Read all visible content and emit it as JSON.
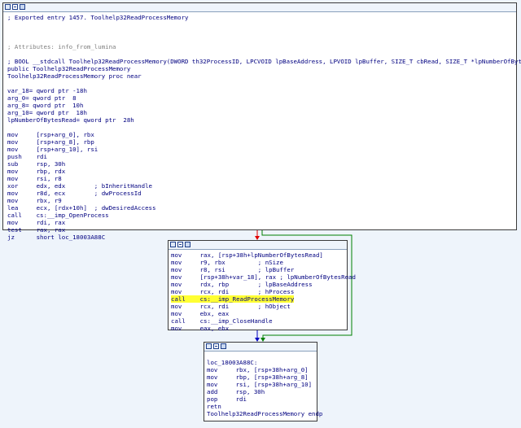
{
  "colors": {
    "background": "#eef4fb",
    "code_text": "#000080",
    "variable": "#008000",
    "import": "#ff00ff",
    "highlight": "#ffff33",
    "edge_red": "#e00000",
    "edge_green": "#008000",
    "edge_blue": "#0000c0"
  },
  "block1": {
    "lines": [
      "; Exported entry 1457. Toolhelp32ReadProcessMemory",
      "",
      "",
      "",
      "; Attributes: info_from_lumina",
      "",
      "; BOOL __stdcall Toolhelp32ReadProcessMemory(DWORD th32ProcessID, LPCVOID lpBaseAddress, LPVOID lpBuffer, SIZE_T cbRead, SIZE_T *lpNumberOfBytesRead)",
      "public Toolhelp32ReadProcessMemory",
      "Toolhelp32ReadProcessMemory proc near",
      "",
      "var_18= qword ptr -18h",
      "arg_0= qword ptr  8",
      "arg_8= qword ptr  10h",
      "arg_10= qword ptr  18h",
      "lpNumberOfBytesRead= qword ptr  28h",
      "",
      "mov     [rsp+arg_0], rbx",
      "mov     [rsp+arg_8], rbp",
      "mov     [rsp+arg_10], rsi",
      "push    rdi",
      "sub     rsp, 30h",
      "mov     rbp, rdx",
      "mov     rsi, r8",
      "xor     edx, edx        ; bInheritHandle",
      "mov     r8d, ecx        ; dwProcessId",
      "mov     rbx, r9",
      "lea     ecx, [rdx+10h]  ; dwDesiredAccess",
      "call    cs:__imp_OpenProcess",
      "mov     rdi, rax",
      "test    rax, rax",
      "jz      short loc_18003A88C"
    ]
  },
  "block2": {
    "lines": [
      "mov     rax, [rsp+38h+lpNumberOfBytesRead]",
      "mov     r9, rbx         ; nSize",
      "mov     r8, rsi         ; lpBuffer",
      "mov     [rsp+38h+var_18], rax ; lpNumberOfBytesRead",
      "mov     rdx, rbp        ; lpBaseAddress",
      "mov     rcx, rdi        ; hProcess",
      "call    cs:__imp_ReadProcessMemory",
      "mov     rcx, rdi        ; hObject",
      "mov     ebx, eax",
      "call    cs:__imp_CloseHandle",
      "mov     eax, ebx"
    ]
  },
  "block3": {
    "lines": [
      "",
      "loc_18003A88C:",
      "mov     rbx, [rsp+38h+arg_0]",
      "mov     rbp, [rsp+38h+arg_8]",
      "mov     rsi, [rsp+38h+arg_10]",
      "add     rsp, 30h",
      "pop     rdi",
      "retn",
      "Toolhelp32ReadProcessMemory endp"
    ]
  }
}
